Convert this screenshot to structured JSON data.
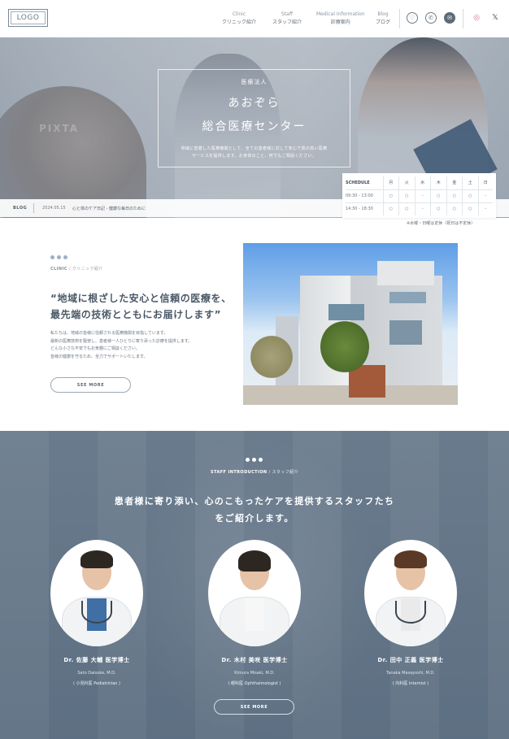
{
  "header": {
    "logo_text": "LOGO",
    "nav": [
      {
        "en": "Clinic",
        "jp": "クリニック紹介"
      },
      {
        "en": "Staff",
        "jp": "スタッフ紹介"
      },
      {
        "en": "Medical Information",
        "jp": "診療案内"
      },
      {
        "en": "Blog",
        "jp": "ブログ"
      }
    ],
    "icons": [
      "heart-icon",
      "phone-icon",
      "mail-icon",
      "instagram-icon",
      "x-icon"
    ]
  },
  "hero": {
    "watermark": "PIXTA",
    "subtitle": "医療法人",
    "title_line1": "あおぞら",
    "title_line2": "総合医療センター",
    "desc_line1": "地域に密着した医療機関として、全ての患者様に対して安心で質の高い医療",
    "desc_line2": "サービスを提供します。お身体のこと、何でもご相談ください。"
  },
  "blog": {
    "label": "BLOG",
    "date": "2024.05.15",
    "title": "心と体のケア日記 - 健康な毎日のために"
  },
  "schedule": {
    "header_label": "SCHEDULE",
    "days": [
      "月",
      "火",
      "水",
      "木",
      "金",
      "土",
      "日"
    ],
    "rows": [
      {
        "time": "09:30 - 13:00",
        "marks": [
          "○",
          "○",
          "-",
          "○",
          "○",
          "○",
          "-"
        ]
      },
      {
        "time": "14:30 - 18:30",
        "marks": [
          "○",
          "○",
          "-",
          "○",
          "○",
          "○",
          "-"
        ]
      }
    ],
    "note": "※水曜・日曜は定休（祝日は不定休）"
  },
  "clinic": {
    "label_en": "CLINIC",
    "label_jp": " / クリニック紹介",
    "heading_line1": "“地域に根ざした安心と信頼の医療を、",
    "heading_line2": "最先端の技術とともにお届けします”",
    "body": [
      "私たちは、地域の皆様に信頼される医療機関を目指しています。",
      "最新の医療技術を駆使し、患者様一人ひとりに寄り添った診療を提供します。",
      "どんな小さな不安でもお気軽にご相談ください。",
      "皆様の健康を守るため、全力でサポートいたします。"
    ],
    "button_label": "SEE MORE"
  },
  "staff": {
    "label_en": "STAFF INTRODUCTION",
    "label_jp": " / スタッフ紹介",
    "heading_line1": "患者様に寄り添い、心のこもったケアを提供するスタッフたち",
    "heading_line2": "をご紹介します。",
    "doctors": [
      {
        "name": "Dr. 佐藤 大輔 医学博士",
        "roman": "Sato Daisuke, M.D.",
        "spec": "( 小児科医 Pediatrician )"
      },
      {
        "name": "Dr. 木村 美咲 医学博士",
        "roman": "Kimura Misaki, M.D.",
        "spec": "( 眼科医 Ophthalmologist )"
      },
      {
        "name": "Dr. 田中 正義 医学博士",
        "roman": "Tanaka Masayoshi, M.D.",
        "spec": "( 内科医 Internist )"
      }
    ],
    "button_label": "SEE MORE"
  }
}
